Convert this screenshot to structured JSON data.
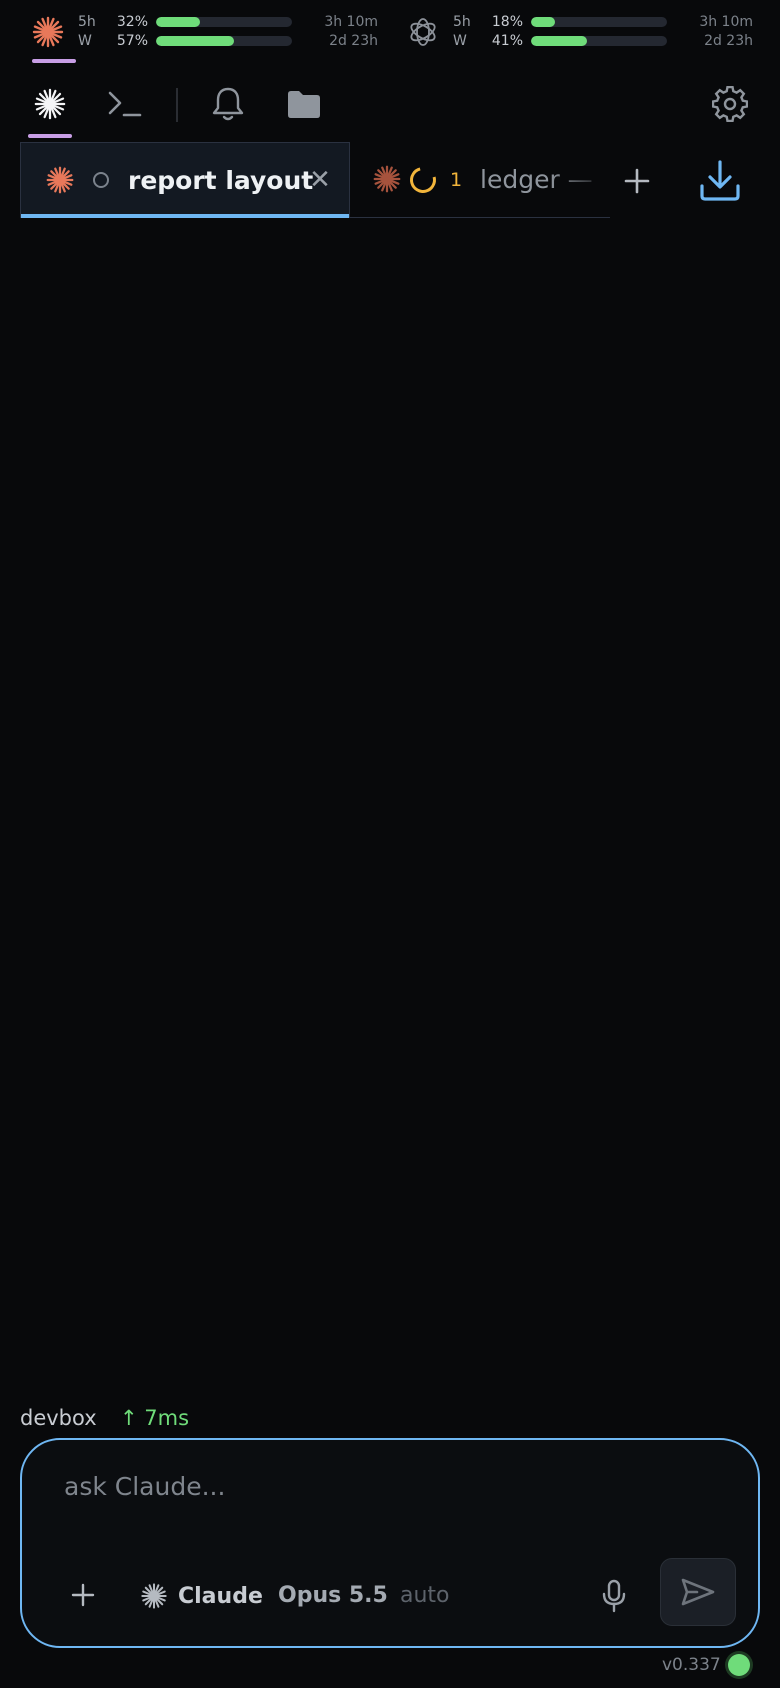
{
  "usage": {
    "providers": [
      {
        "name": "claude-icon",
        "rows": [
          {
            "label": "5h",
            "pct": "32%",
            "fill": 0.32,
            "reset": "3h 10m"
          },
          {
            "label": "W",
            "pct": "57%",
            "fill": 0.57,
            "reset": "2d 23h"
          }
        ]
      },
      {
        "name": "openai-icon",
        "rows": [
          {
            "label": "5h",
            "pct": "18%",
            "fill": 0.18,
            "reset": "3h 10m"
          },
          {
            "label": "W",
            "pct": "41%",
            "fill": 0.41,
            "reset": "2d 23h"
          }
        ]
      }
    ]
  },
  "tabs": [
    {
      "title": "report layout",
      "active": true,
      "status": "idle"
    },
    {
      "title": "ledger —",
      "active": false,
      "status": "running",
      "count": "1"
    }
  ],
  "footer": {
    "host": "devbox",
    "latency": "↑ 7ms",
    "prompt_placeholder": "ask Claude...",
    "agent": "Claude",
    "model": "Opus 5.5",
    "mode": "auto",
    "version": "v0.337"
  },
  "colors": {
    "background": "#08090b",
    "accent_blue": "#6fb7f3",
    "accent_purple": "#c89ee6",
    "claude_orange": "#e8785a",
    "usage_green": "#6fdc7a",
    "running_amber": "#f2b53b"
  }
}
